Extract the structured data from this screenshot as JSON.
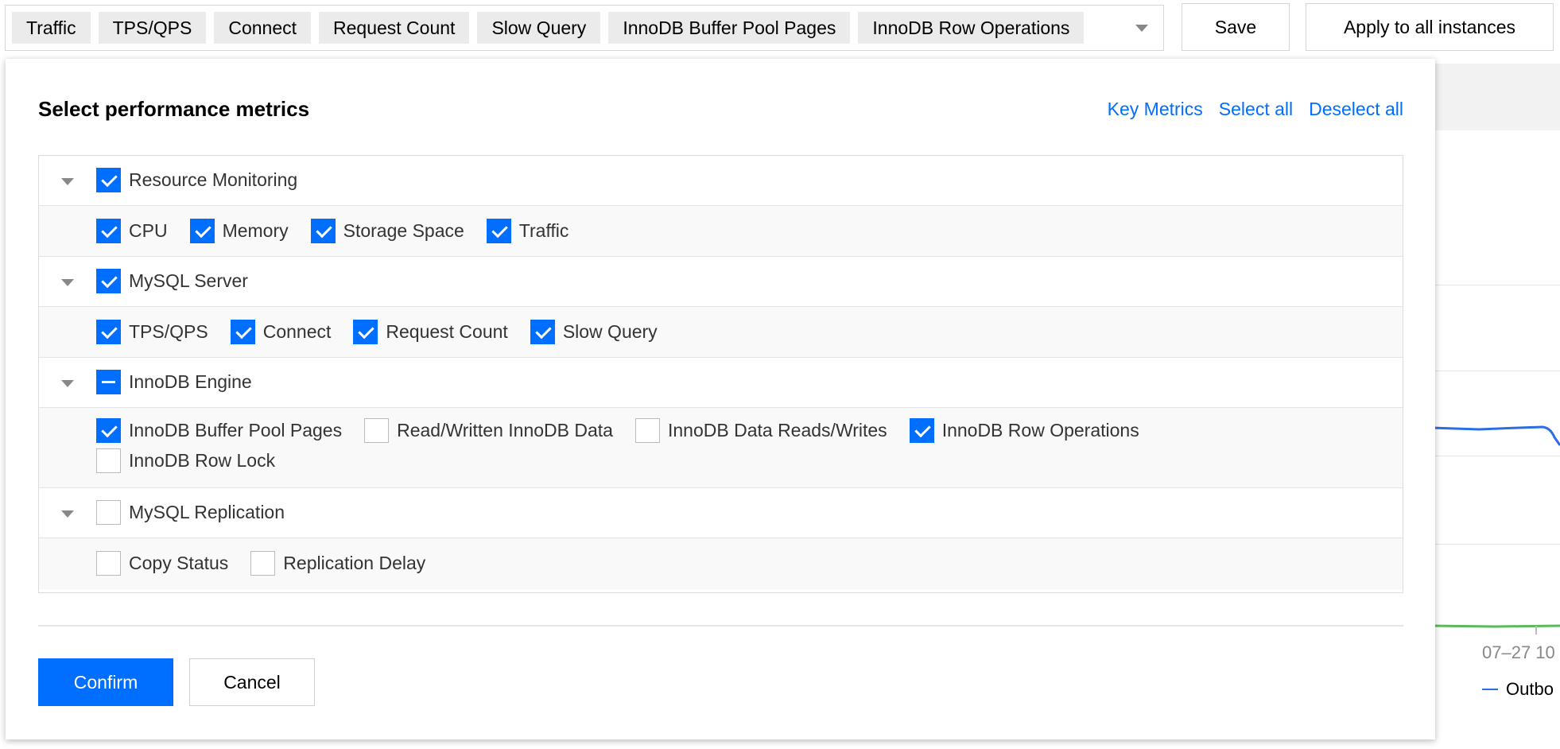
{
  "toolbar": {
    "tags": [
      "Traffic",
      "TPS/QPS",
      "Connect",
      "Request Count",
      "Slow Query",
      "InnoDB Buffer Pool Pages",
      "InnoDB Row Operations"
    ],
    "save_label": "Save",
    "apply_label": "Apply to all instances"
  },
  "popup": {
    "title": "Select performance metrics",
    "links": {
      "key_metrics": "Key Metrics",
      "select_all": "Select all",
      "deselect_all": "Deselect all"
    },
    "groups": [
      {
        "name": "Resource Monitoring",
        "state": "checked",
        "items": [
          {
            "label": "CPU",
            "checked": true
          },
          {
            "label": "Memory",
            "checked": true
          },
          {
            "label": "Storage Space",
            "checked": true
          },
          {
            "label": "Traffic",
            "checked": true
          }
        ]
      },
      {
        "name": "MySQL Server",
        "state": "checked",
        "items": [
          {
            "label": "TPS/QPS",
            "checked": true
          },
          {
            "label": "Connect",
            "checked": true
          },
          {
            "label": "Request Count",
            "checked": true
          },
          {
            "label": "Slow Query",
            "checked": true
          }
        ]
      },
      {
        "name": "InnoDB Engine",
        "state": "indeterminate",
        "items": [
          {
            "label": "InnoDB Buffer Pool Pages",
            "checked": true
          },
          {
            "label": "Read/Written InnoDB Data",
            "checked": false
          },
          {
            "label": "InnoDB Data Reads/Writes",
            "checked": false
          },
          {
            "label": "InnoDB Row Operations",
            "checked": true
          },
          {
            "label": "InnoDB Row Lock",
            "checked": false
          }
        ]
      },
      {
        "name": "MySQL Replication",
        "state": "unchecked",
        "items": [
          {
            "label": "Copy Status",
            "checked": false
          },
          {
            "label": "Replication Delay",
            "checked": false
          }
        ]
      }
    ],
    "confirm_label": "Confirm",
    "cancel_label": "Cancel"
  },
  "background": {
    "date_label": "07–27 10",
    "legend_label": "Outbo"
  },
  "colors": {
    "accent": "#006eff",
    "series_blue": "#2b6de5",
    "series_green": "#5cb85c"
  }
}
